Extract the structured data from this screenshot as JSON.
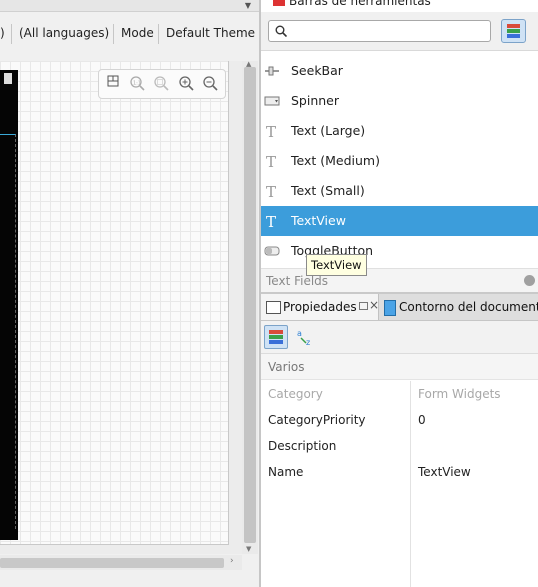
{
  "editor": {
    "toolbar": {
      "paren_fragment": ")",
      "language": "(All languages)",
      "mode": "Mode",
      "theme": "Default Theme"
    },
    "zoom_controls": [
      "zoom-emulate-icon",
      "zoom-real-size-icon",
      "zoom-fit-icon",
      "zoom-in-icon",
      "zoom-out-icon"
    ]
  },
  "palette": {
    "title": "Barras de herramientas",
    "search": {
      "value": "",
      "placeholder": ""
    },
    "items": [
      {
        "label": "SeekBar",
        "icon": "seekbar-icon",
        "selected": false
      },
      {
        "label": "Spinner",
        "icon": "spinner-icon",
        "selected": false
      },
      {
        "label": "Text (Large)",
        "icon": "text-icon",
        "selected": false
      },
      {
        "label": "Text (Medium)",
        "icon": "text-icon",
        "selected": false
      },
      {
        "label": "Text (Small)",
        "icon": "text-icon",
        "selected": false
      },
      {
        "label": "TextView",
        "icon": "text-icon",
        "selected": true
      },
      {
        "label": "ToggleButton",
        "icon": "toggle-icon",
        "selected": false
      }
    ],
    "section_next": "Text Fields",
    "tooltip": "TextView"
  },
  "properties": {
    "tabs": {
      "active": "Propiedades",
      "other": "Contorno del documento"
    },
    "group": "Varios",
    "rows": [
      {
        "name": "Category",
        "value": "Form Widgets",
        "disabled": true
      },
      {
        "name": "CategoryPriority",
        "value": "0",
        "disabled": false
      },
      {
        "name": "Description",
        "value": "",
        "disabled": false
      },
      {
        "name": "Name",
        "value": "TextView",
        "disabled": false
      }
    ]
  },
  "colors": {
    "selection": "#3c9ddb",
    "tooltip_bg": "#ffffe1",
    "toggle_active_bg": "#cfe2f5"
  }
}
